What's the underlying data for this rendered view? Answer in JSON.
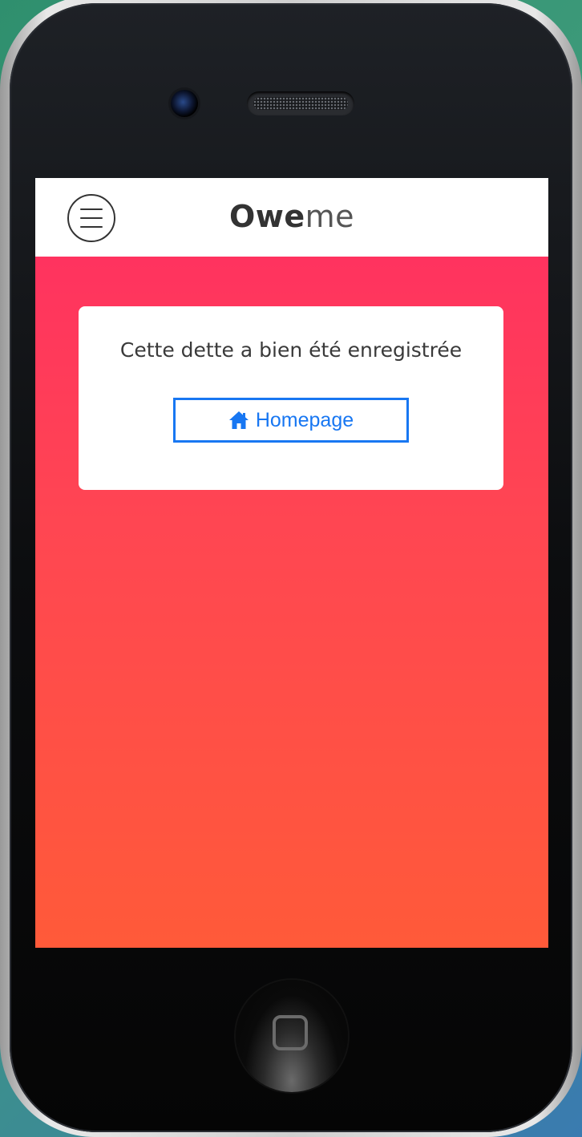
{
  "app": {
    "brand_bold": "Owe",
    "brand_light": "me"
  },
  "card": {
    "message": "Cette dette a bien été enregistrée",
    "home_button_label": "Homepage"
  },
  "icons": {
    "menu": "menu-icon",
    "home": "home-icon"
  },
  "colors": {
    "gradient_top": "#ff2d63",
    "gradient_bottom": "#ff5a39",
    "link_blue": "#1877f2"
  }
}
